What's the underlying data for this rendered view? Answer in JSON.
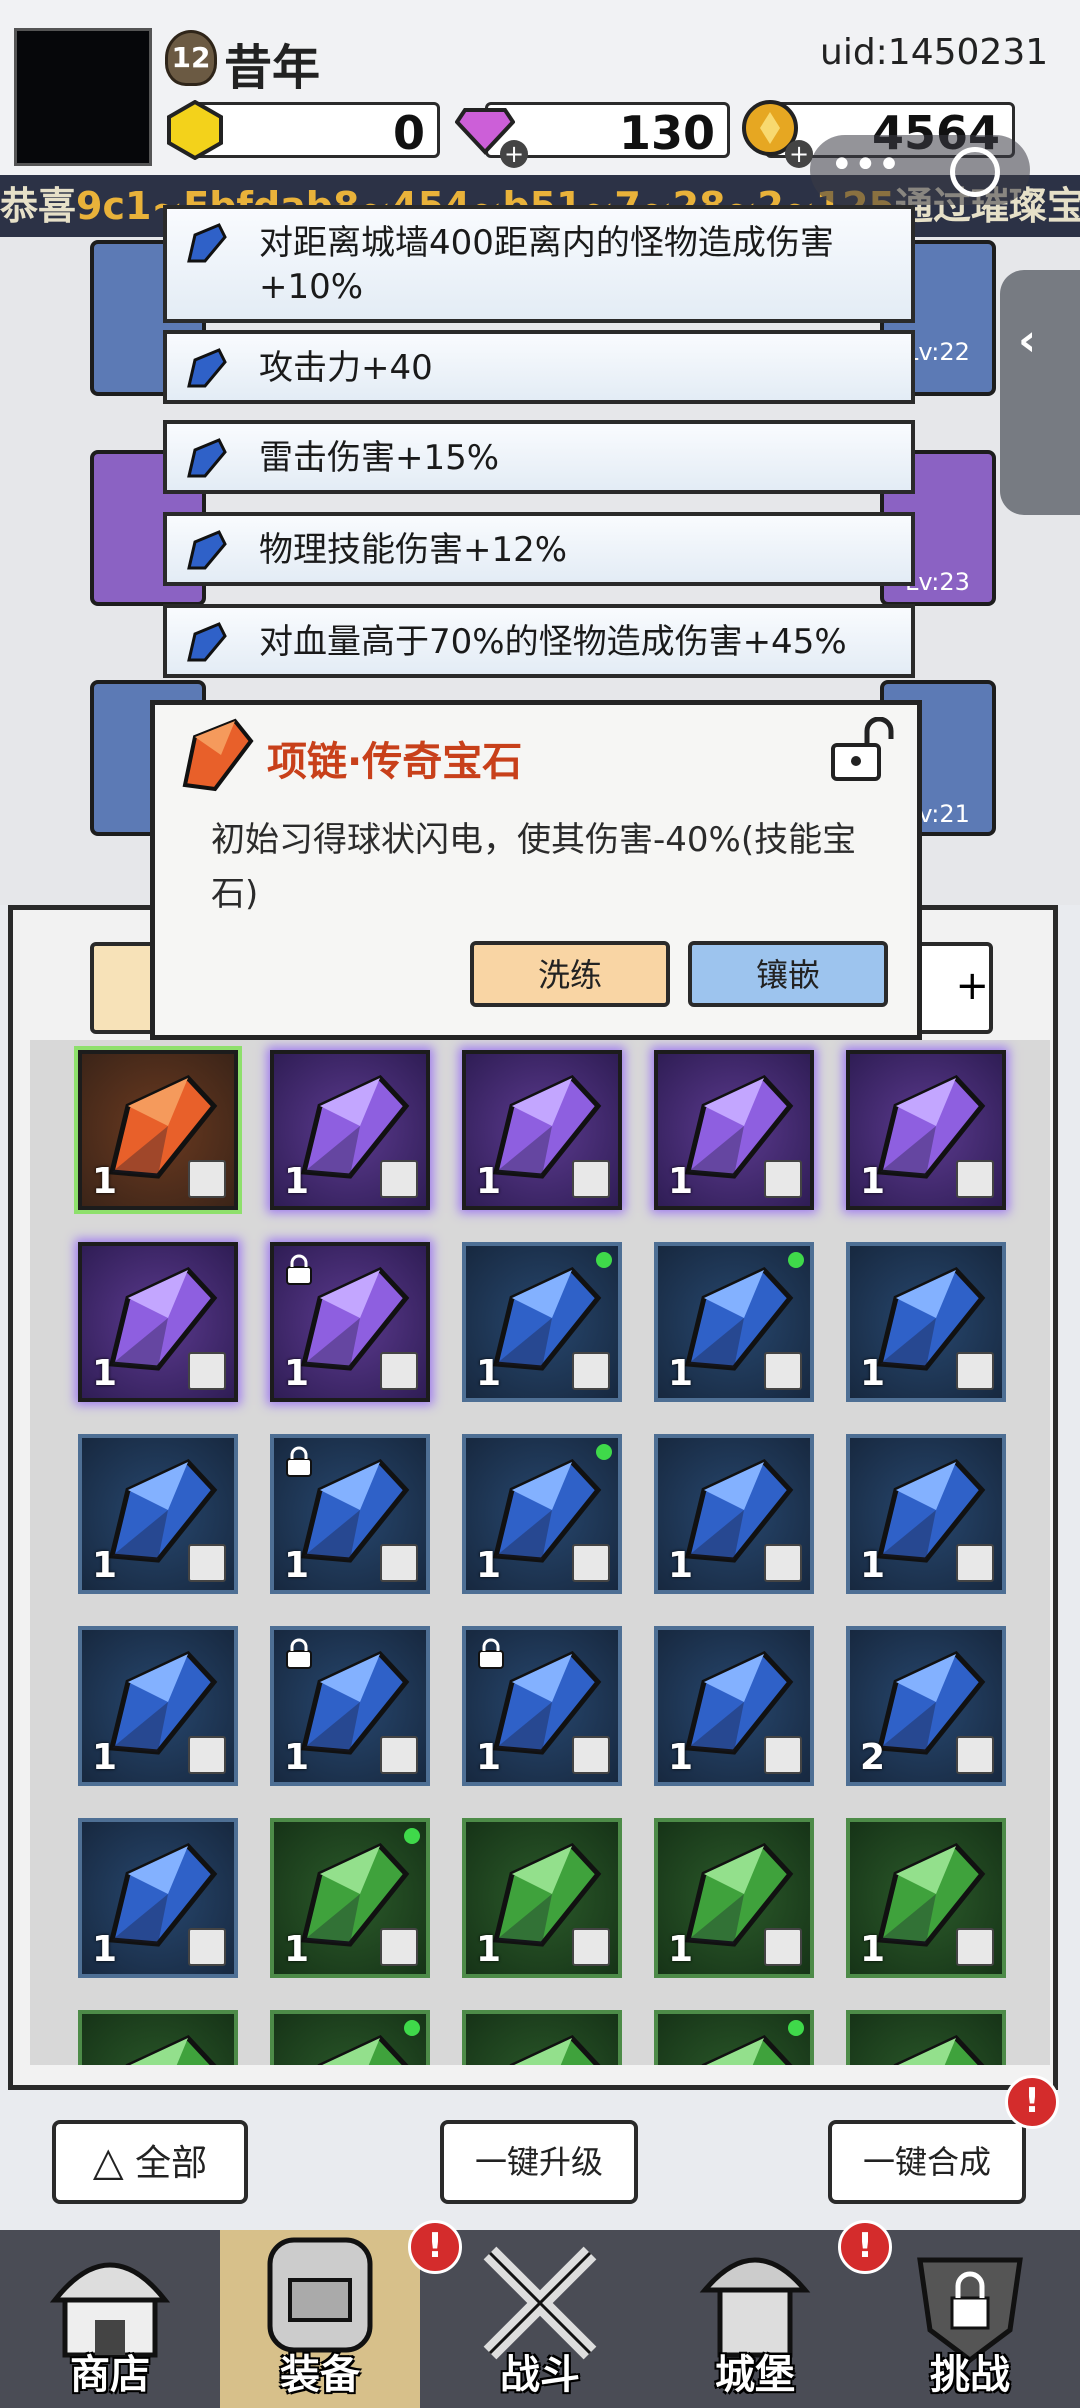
{
  "header": {
    "level": "12",
    "player_name": "昔年",
    "uid": "uid:1450231",
    "gold": "0",
    "diamond": "130",
    "coin": "4564"
  },
  "banner": {
    "prefix": "恭喜",
    "highlight": "9c1~Fbfdab8~454~b51~7~28~2~125",
    "suffix": "通过璀璨宝"
  },
  "equip_levels": [
    "Lv:22",
    "Lv:23",
    "Lv:21"
  ],
  "attributes": [
    "对距离城墙400距离内的怪物造成伤害+10%",
    "攻击力+40",
    "雷击伤害+15%",
    "物理技能伤害+12%",
    "对血量高于70%的怪物造成伤害+45%"
  ],
  "popup": {
    "title": "项链·传奇宝石",
    "description": "初始习得球状闪电，使其伤害-40%(技能宝石)",
    "refine_label": "洗练",
    "inlay_label": "镶嵌"
  },
  "inventory": {
    "rows": [
      [
        {
          "color": "orange",
          "count": "1"
        },
        {
          "color": "purple",
          "count": "1"
        },
        {
          "color": "purple",
          "count": "1"
        },
        {
          "color": "purple",
          "count": "1"
        },
        {
          "color": "purple",
          "count": "1"
        }
      ],
      [
        {
          "color": "purple",
          "count": "1"
        },
        {
          "color": "purple",
          "count": "1",
          "locked": true
        },
        {
          "color": "blue",
          "count": "1",
          "new": true
        },
        {
          "color": "blue",
          "count": "1",
          "new": true
        },
        {
          "color": "blue",
          "count": "1"
        }
      ],
      [
        {
          "color": "blue",
          "count": "1"
        },
        {
          "color": "blue",
          "count": "1",
          "locked": true
        },
        {
          "color": "blue",
          "count": "1",
          "new": true
        },
        {
          "color": "blue",
          "count": "1"
        },
        {
          "color": "blue",
          "count": "1"
        }
      ],
      [
        {
          "color": "blue",
          "count": "1"
        },
        {
          "color": "blue",
          "count": "1",
          "locked": true
        },
        {
          "color": "blue",
          "count": "1",
          "locked": true
        },
        {
          "color": "blue",
          "count": "1"
        },
        {
          "color": "blue",
          "count": "2"
        }
      ],
      [
        {
          "color": "blue",
          "count": "1"
        },
        {
          "color": "green",
          "count": "1",
          "new": true
        },
        {
          "color": "green",
          "count": "1"
        },
        {
          "color": "green",
          "count": "1"
        },
        {
          "color": "green",
          "count": "1"
        }
      ],
      [
        {
          "color": "green",
          "count": ""
        },
        {
          "color": "green",
          "count": "",
          "new": true
        },
        {
          "color": "green",
          "count": ""
        },
        {
          "color": "green",
          "count": "",
          "new": true
        },
        {
          "color": "green",
          "count": ""
        }
      ]
    ]
  },
  "actions": {
    "filter_label": "全部",
    "upgrade_label": "一键升级",
    "merge_label": "一键合成"
  },
  "nav": {
    "shop": "商店",
    "equipment": "装备",
    "battle": "战斗",
    "castle": "城堡",
    "challenge": "挑战"
  },
  "colors": {
    "purple": "#5b3a8e",
    "blue": "#27476e",
    "green": "#2b5a2a",
    "orange": "#6b3a20",
    "legend_title": "#c8401a"
  }
}
